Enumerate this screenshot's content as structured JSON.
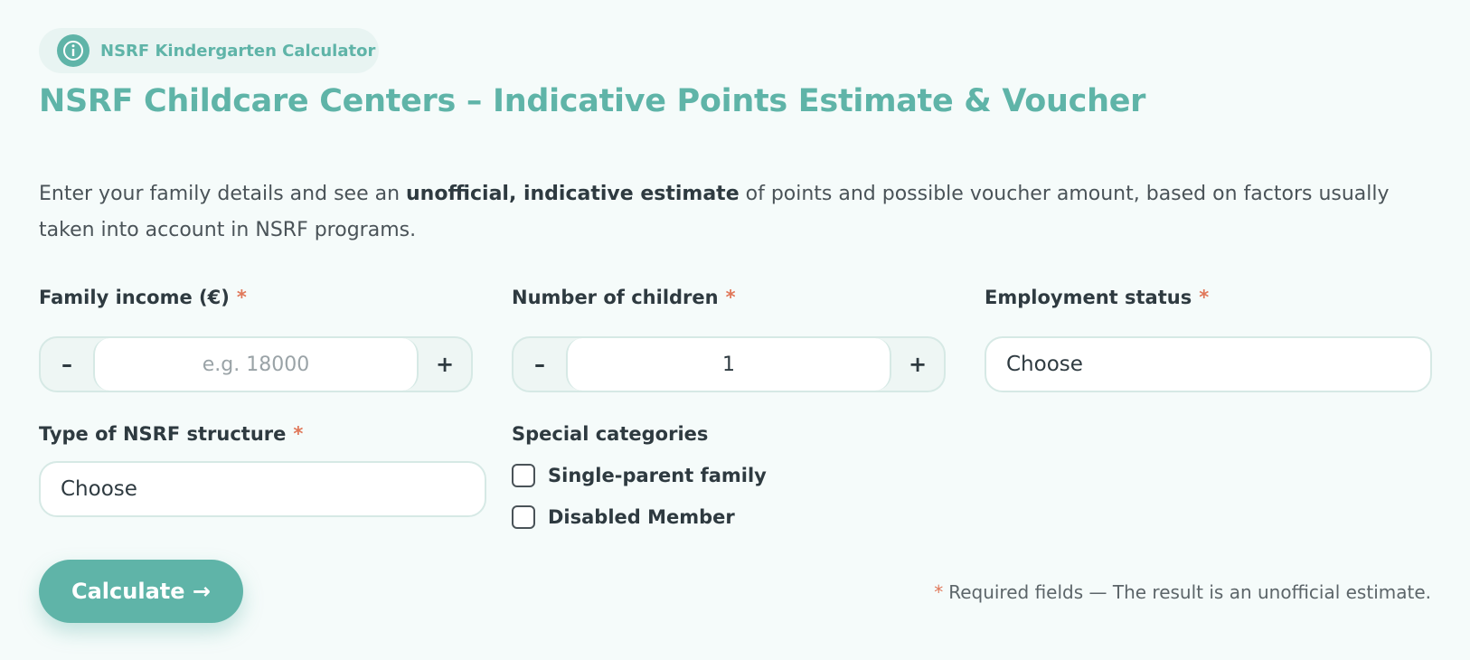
{
  "badge": {
    "icon": "info-icon",
    "label": "NSRF Kindergarten Calculator"
  },
  "title": "NSRF Childcare Centers – Indicative Points Estimate & Voucher",
  "intro": {
    "part1": "Enter your family details and see an ",
    "bold": "unofficial, indicative estimate",
    "part2": " of points and possible voucher amount, based on factors usually taken into account in NSRF programs."
  },
  "form": {
    "required_marker": "*",
    "income": {
      "label": "Family income (€)",
      "placeholder": "e.g. 18000",
      "value": "",
      "decrement": "–",
      "increment": "+"
    },
    "children": {
      "label": "Number of children",
      "value": "1",
      "decrement": "–",
      "increment": "+"
    },
    "employment": {
      "label": "Employment status",
      "selected": "Choose"
    },
    "structure": {
      "label": "Type of NSRF structure",
      "selected": "Choose"
    },
    "special": {
      "label": "Special categories",
      "options": [
        {
          "label": "Single-parent family",
          "checked": false
        },
        {
          "label": "Disabled Member",
          "checked": false
        }
      ]
    }
  },
  "actions": {
    "calculate_label": "Calculate →"
  },
  "footnote": {
    "star": "*",
    "text": "Required fields — The result is an unofficial estimate."
  },
  "colors": {
    "accent": "#5fb4a8",
    "required": "#e0785a",
    "background": "#f5fbfa",
    "text": "#2e3a40"
  }
}
